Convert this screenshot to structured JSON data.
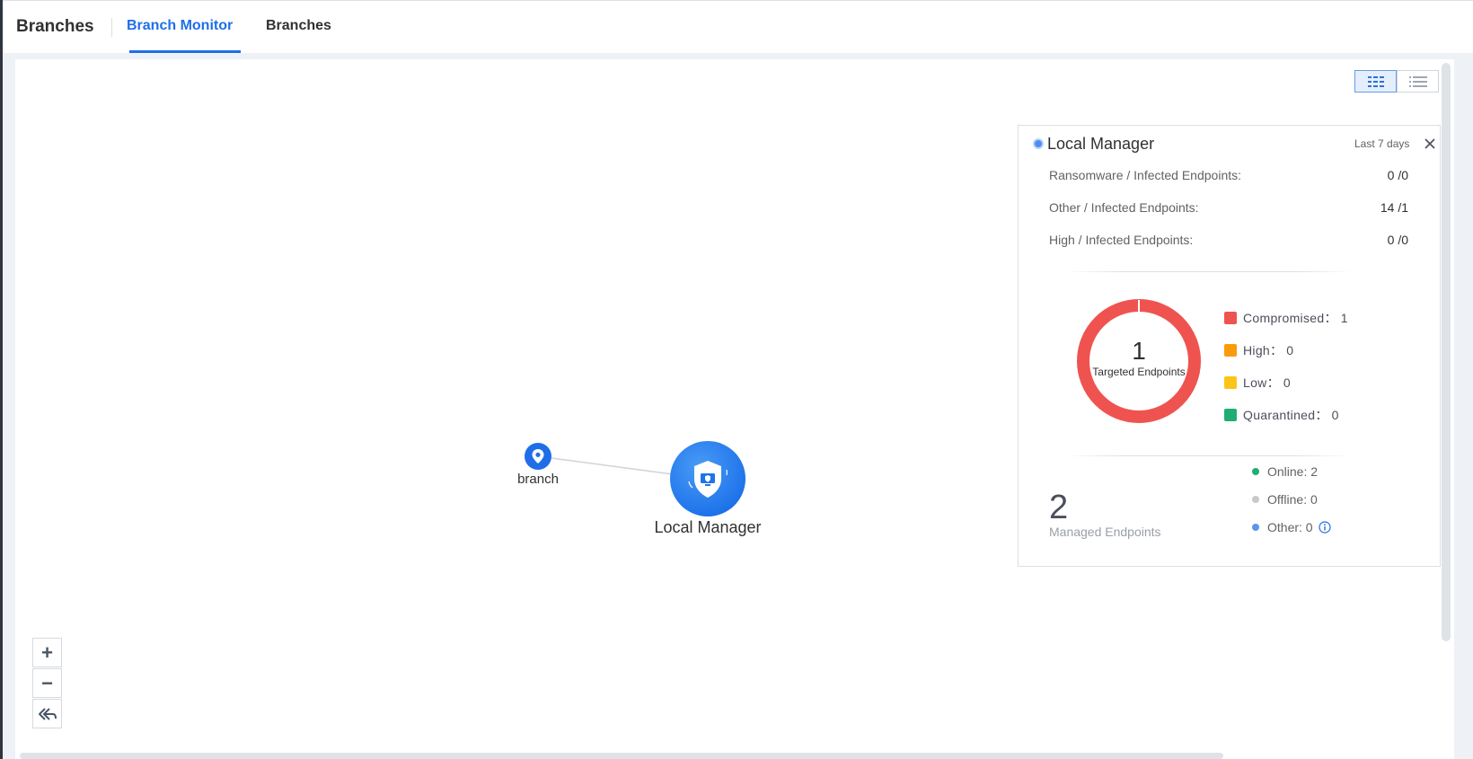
{
  "header": {
    "title": "Branches",
    "tabs": [
      {
        "label": "Branch Monitor",
        "active": true
      },
      {
        "label": "Branches",
        "active": false
      }
    ]
  },
  "view_toggle": {
    "options": [
      "grid-view-icon",
      "list-view-icon"
    ],
    "active": "grid-view-icon"
  },
  "topology": {
    "nodes": [
      {
        "label": "branch",
        "icon": "location-pin-icon"
      },
      {
        "label": "Local Manager",
        "icon": "shield-icon"
      }
    ]
  },
  "zoom_controls": {
    "zoom_in": "+",
    "zoom_out": "−",
    "reset_icon": "double-back-arrow-icon"
  },
  "panel": {
    "title": "Local Manager",
    "range": "Last 7 days",
    "stats": [
      {
        "label": "Ransomware / Infected Endpoints:",
        "value": "0 /0"
      },
      {
        "label": "Other / Infected Endpoints:",
        "value": "14 /1"
      },
      {
        "label": "High / Infected Endpoints:",
        "value": "0 /0"
      }
    ],
    "donut": {
      "center_value": "1",
      "center_label": "Targeted Endpoints",
      "legend": [
        {
          "label": "Compromised：",
          "value": "1",
          "color": "#ef5350"
        },
        {
          "label": "High：",
          "value": "0",
          "color": "#fb9b0b"
        },
        {
          "label": "Low：",
          "value": "0",
          "color": "#fcc419"
        },
        {
          "label": "Quarantined：",
          "value": "0",
          "color": "#20ad73"
        }
      ]
    },
    "managed": {
      "value": "2",
      "label": "Managed Endpoints",
      "status": [
        {
          "label": "Online: 2",
          "color": "#20ad73"
        },
        {
          "label": "Offline: 0",
          "color": "#c7c9cc"
        },
        {
          "label": "Other: 0",
          "color": "#5b95ef",
          "info": true
        }
      ]
    }
  }
}
